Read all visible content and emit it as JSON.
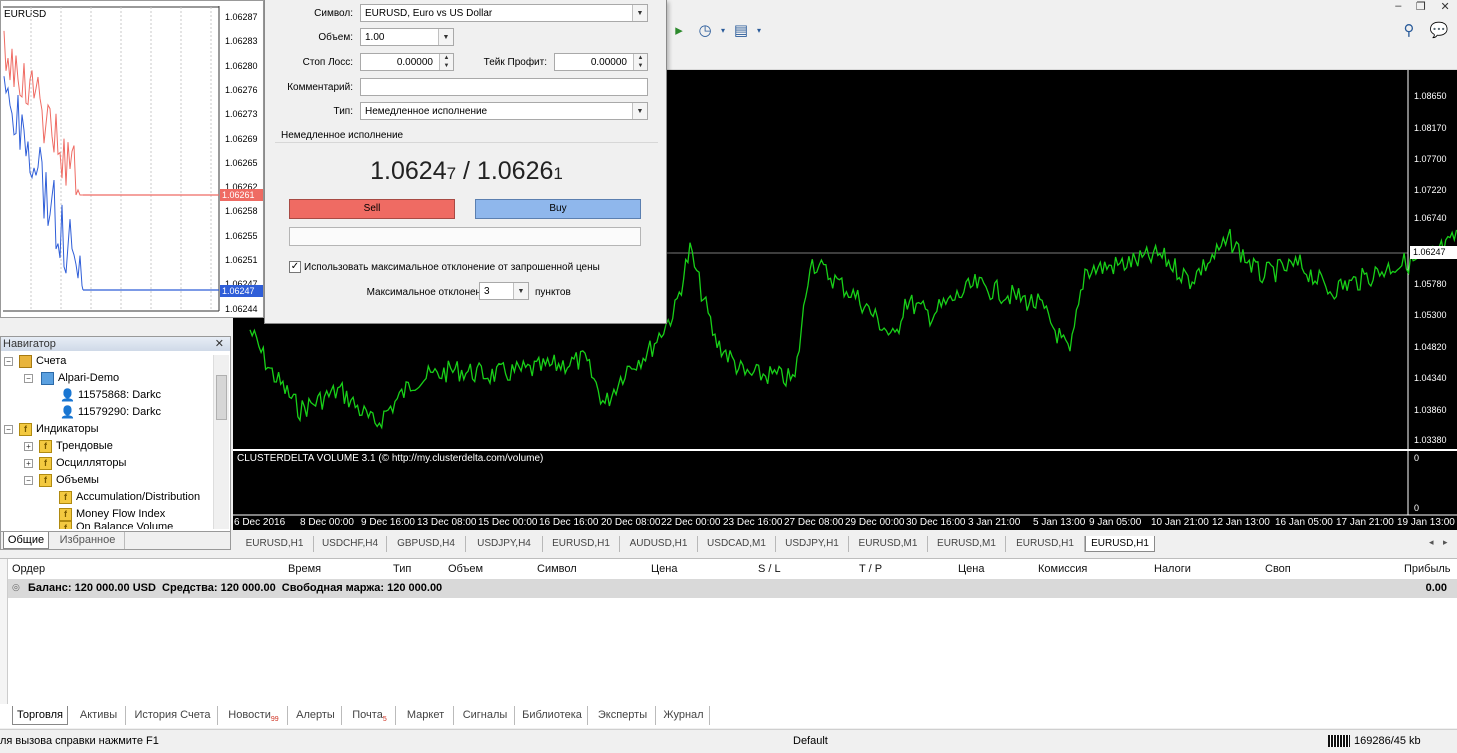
{
  "mini_chart": {
    "symbol": "EURUSD",
    "prices": [
      "1.06287",
      "1.06283",
      "1.06280",
      "1.06276",
      "1.06273",
      "1.06269",
      "1.06265",
      "1.06262",
      "1.06258",
      "1.06255",
      "1.06251",
      "1.06247",
      "1.06244"
    ],
    "ask_tag": "1.06261",
    "bid_tag": "1.06247"
  },
  "dialog": {
    "symbol_label": "Символ:",
    "symbol_value": "EURUSD, Euro vs US Dollar",
    "volume_label": "Объем:",
    "volume_value": "1.00",
    "sl_label": "Стоп Лосс:",
    "sl_value": "0.00000",
    "tp_label": "Тейк Профит:",
    "tp_value": "0.00000",
    "comment_label": "Комментарий:",
    "comment_value": "",
    "type_label": "Тип:",
    "type_value": "Немедленное исполнение",
    "section_title": "Немедленное исполнение",
    "bid_main": "1.0624",
    "bid_small": "7",
    "separator": " / ",
    "ask_main": "1.0626",
    "ask_small": "1",
    "sell_label": "Sell",
    "buy_label": "Buy",
    "deviation_check": "Использовать максимальное отклонение от запрошенной цены",
    "deviation_label": "Максимальное отклонение:",
    "deviation_value": "3",
    "deviation_unit": "пунктов"
  },
  "navigator": {
    "title": "Навигатор",
    "items": [
      "Счета",
      "Alpari-Demo",
      "11575868: Darkc",
      "11579290: Darkc",
      "Индикаторы",
      "Трендовые",
      "Осцилляторы",
      "Объемы",
      "Accumulation/Distribution",
      "Money Flow Index",
      "On Balance Volume"
    ],
    "tabs": [
      "Общие",
      "Избранное"
    ]
  },
  "main_chart": {
    "price_labels": [
      "1.08650",
      "1.08170",
      "1.07700",
      "1.07220",
      "1.06740",
      "1.06247",
      "1.05780",
      "1.05300",
      "1.04820",
      "1.04340",
      "1.03860",
      "1.03380"
    ],
    "indicator_title": "CLUSTERDELTA VOLUME 3.1 (© http://my.clusterdelta.com/volume)",
    "indicator_scale": [
      "0",
      "0"
    ],
    "time_labels": [
      "6 Dec 2016",
      "8 Dec 00:00",
      "9 Dec 16:00",
      "13 Dec 08:00",
      "15 Dec 00:00",
      "16 Dec 16:00",
      "20 Dec 08:00",
      "22 Dec 00:00",
      "23 Dec 16:00",
      "27 Dec 08:00",
      "29 Dec 00:00",
      "30 Dec 16:00",
      "3 Jan 21:00",
      "5 Jan 13:00",
      "9 Jan 05:00",
      "10 Jan 21:00",
      "12 Jan 13:00",
      "16 Jan 05:00",
      "17 Jan 21:00",
      "19 Jan 13:00"
    ]
  },
  "chart_tabs": [
    "EURUSD,H1",
    "USDCHF,H4",
    "GBPUSD,H4",
    "USDJPY,H4",
    "EURUSD,H1",
    "AUDUSD,H1",
    "USDCAD,M1",
    "USDJPY,H1",
    "EURUSD,M1",
    "EURUSD,M1",
    "EURUSD,H1",
    "EURUSD,H1"
  ],
  "terminal": {
    "columns": [
      "Ордер",
      "Время",
      "Тип",
      "Объем",
      "Символ",
      "Цена",
      "S / L",
      "T / P",
      "Цена",
      "Комиссия",
      "Налоги",
      "Своп",
      "Прибыль"
    ],
    "balance_row": "Баланс: 120 000.00 USD  Средства: 120 000.00  Свободная маржа: 120 000.00",
    "profit": "0.00",
    "tabs": [
      "Торговля",
      "Активы",
      "История Счета",
      "Новости",
      "Алерты",
      "Почта",
      "Маркет",
      "Сигналы",
      "Библиотека",
      "Эксперты",
      "Журнал"
    ],
    "news_badge": "99",
    "mail_badge": "5"
  },
  "status": {
    "help": "ля вызова справки нажмите F1",
    "profile": "Default",
    "traffic": "169286/45 kb"
  },
  "colors": {
    "chart_bg": "#000000",
    "candles": "#18d018",
    "sell": "#ef6b63",
    "buy": "#8fb7ec"
  }
}
